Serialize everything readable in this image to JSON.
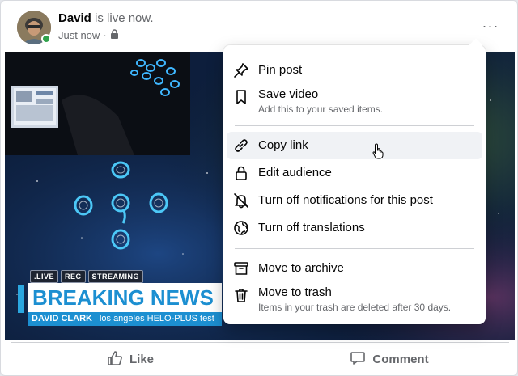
{
  "post": {
    "author": "David",
    "status": "is live now.",
    "time": "Just now",
    "separator": "·",
    "privacy_icon": "lock-icon",
    "more_icon": "more-options-icon",
    "more_label": "···"
  },
  "video": {
    "tags": [
      ".LIVE",
      "REC",
      "STREAMING"
    ],
    "headline": "BREAKING NEWS",
    "ticker_name": "DAVID CLARK",
    "ticker_rest": "| los angeles HELO-PLUS test"
  },
  "menu": {
    "items": [
      {
        "label": "Pin post",
        "sub": "",
        "icon": "pin-icon"
      },
      {
        "label": "Save video",
        "sub": "Add this to your saved items.",
        "icon": "bookmark-icon"
      },
      {
        "label": "Copy link",
        "sub": "",
        "icon": "link-icon"
      },
      {
        "label": "Edit audience",
        "sub": "",
        "icon": "lock-icon"
      },
      {
        "label": "Turn off notifications for this post",
        "sub": "",
        "icon": "bell-off-icon"
      },
      {
        "label": "Turn off translations",
        "sub": "",
        "icon": "globe-icon"
      },
      {
        "label": "Move to archive",
        "sub": "",
        "icon": "archive-icon"
      },
      {
        "label": "Move to trash",
        "sub": "Items in your trash are deleted after 30 days.",
        "icon": "trash-icon"
      }
    ]
  },
  "actions": {
    "like": "Like",
    "comment": "Comment"
  },
  "colors": {
    "online": "#31a24c",
    "news_blue": "#1c8fd1",
    "menu_hover": "#f0f2f5",
    "secondary_text": "#65676b"
  }
}
